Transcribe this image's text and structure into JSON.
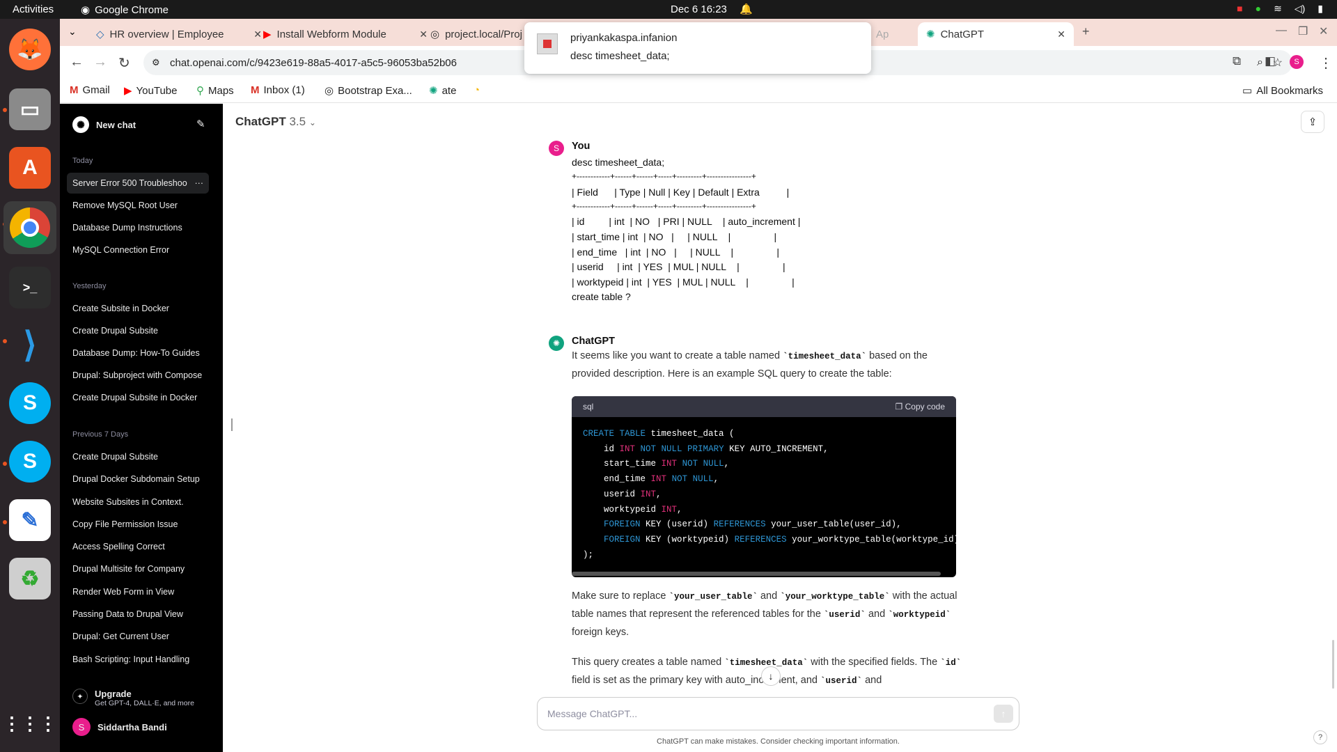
{
  "topbar": {
    "activities": "Activities",
    "app": "Google Chrome",
    "clock": "Dec 6  16:23"
  },
  "tabs": [
    {
      "label": "HR overview | Employee"
    },
    {
      "label": "Install Webform Module"
    },
    {
      "label": "project.local/Proj"
    },
    {
      "label": "Ap"
    },
    {
      "label": "ChatGPT"
    }
  ],
  "url": "chat.openai.com/c/9423e619-88a5-4017-a5c5-96053ba52b06",
  "bookmarks": [
    "Gmail",
    "YouTube",
    "Maps",
    "Inbox (1)",
    "Bootstrap Exa...",
    "ate",
    "All Bookmarks"
  ],
  "notification": {
    "title": "priyankakaspa.infanion",
    "body": "desc timesheet_data;"
  },
  "sidebar": {
    "new_chat": "New chat",
    "today_label": "Today",
    "today": [
      "Server Error 500 Troubleshoo",
      "Remove MySQL Root User",
      "Database Dump Instructions",
      "MySQL Connection Error"
    ],
    "yesterday_label": "Yesterday",
    "yesterday": [
      "Create Subsite in Docker",
      "Create Drupal Subsite",
      "Database Dump: How-To Guides",
      "Drupal: Subproject with Compose",
      "Create Drupal Subsite in Docker"
    ],
    "prev7_label": "Previous 7 Days",
    "prev7": [
      "Create Drupal Subsite",
      "Drupal Docker Subdomain Setup",
      "Website Subsites in Context.",
      "Copy File Permission Issue",
      "Access Spelling Correct",
      "Drupal Multisite for Company",
      "Render Web Form in View",
      "Passing Data to Drupal View",
      "Drupal: Get Current User",
      "Bash Scripting: Input Handling"
    ],
    "upgrade": "Upgrade",
    "upgrade_sub": "Get GPT-4, DALL·E, and more",
    "user": "Siddartha Bandi",
    "user_initial": "S"
  },
  "main": {
    "model": "ChatGPT",
    "model_version": "3.5",
    "user_name": "You",
    "user_lines": [
      "desc timesheet_data;",
      "+------------+------+------+-----+---------+----------------+",
      "| Field      | Type | Null | Key | Default | Extra          |",
      "+------------+------+------+-----+---------+----------------+",
      "| id         | int  | NO   | PRI | NULL    | auto_increment |",
      "| start_time | int  | NO   |     | NULL    |                |",
      "| end_time   | int  | NO   |     | NULL    |                |",
      "| userid     | int  | YES  | MUL | NULL    |                |",
      "| worktypeid | int  | YES  | MUL | NULL    |                |",
      "create table ?"
    ],
    "bot_name": "ChatGPT",
    "p1a": "It seems like you want to create a table named ",
    "p1code": "`timesheet_data`",
    "p1b": " based on the provided description. Here is an example SQL query to create the table:",
    "code_lang": "sql",
    "copy_label": "Copy code",
    "p2a": "Make sure to replace ",
    "p2c1": "`your_user_table`",
    "p2b": " and ",
    "p2c2": "`your_worktype_table`",
    "p2c": " with the actual table names that represent the referenced tables for the ",
    "p2c3": "`userid`",
    "p2d": " and ",
    "p2c4": "`worktypeid`",
    "p2e": " foreign keys.",
    "p3a": "This query creates a table named ",
    "p3c1": "`timesheet_data`",
    "p3b": " with the specified fields. The ",
    "p3c2": "`id`",
    "p3c": " field is set as the primary key with auto_increment, and ",
    "p3c3": "`userid`",
    "p3d": " and",
    "input_placeholder": "Message ChatGPT...",
    "disclaimer": "ChatGPT can make mistakes. Consider checking important information."
  }
}
